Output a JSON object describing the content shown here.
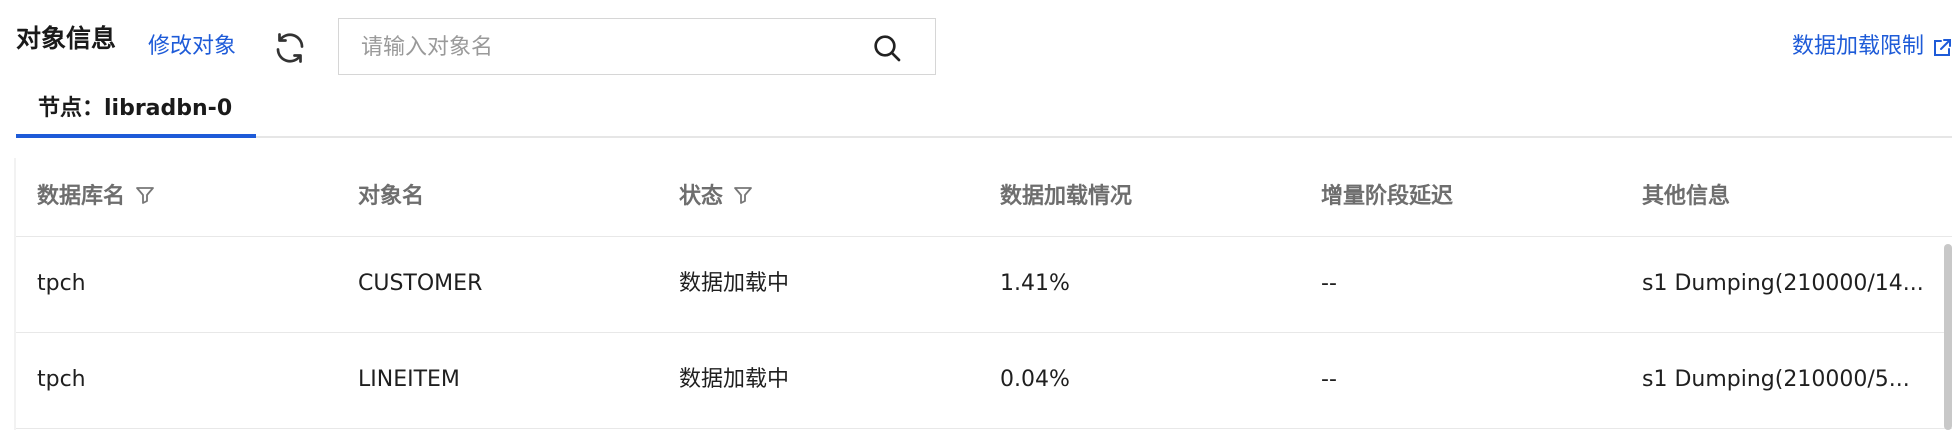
{
  "header": {
    "title": "对象信息",
    "edit_label": "修改对象",
    "search_placeholder": "请输入对象名",
    "limit_label": "数据加载限制",
    "icons": [
      "refresh-icon",
      "search-icon",
      "external-link-icon"
    ],
    "accent_color": "#1e5bd8"
  },
  "tabs": [
    {
      "label": "节点：libradbn-0",
      "active": true
    }
  ],
  "table": {
    "columns": [
      "数据库名",
      "对象名",
      "状态",
      "数据加载情况",
      "增量阶段延迟",
      "其他信息"
    ],
    "filterable": [
      "数据库名",
      "状态"
    ],
    "rows": [
      {
        "db": "tpch",
        "object": "CUSTOMER",
        "status": "数据加载中",
        "load": "1.41%",
        "delay": "--",
        "other": "s1 Dumping(210000/14..."
      },
      {
        "db": "tpch",
        "object": "LINEITEM",
        "status": "数据加载中",
        "load": "0.04%",
        "delay": "--",
        "other": "s1 Dumping(210000/5..."
      }
    ]
  }
}
